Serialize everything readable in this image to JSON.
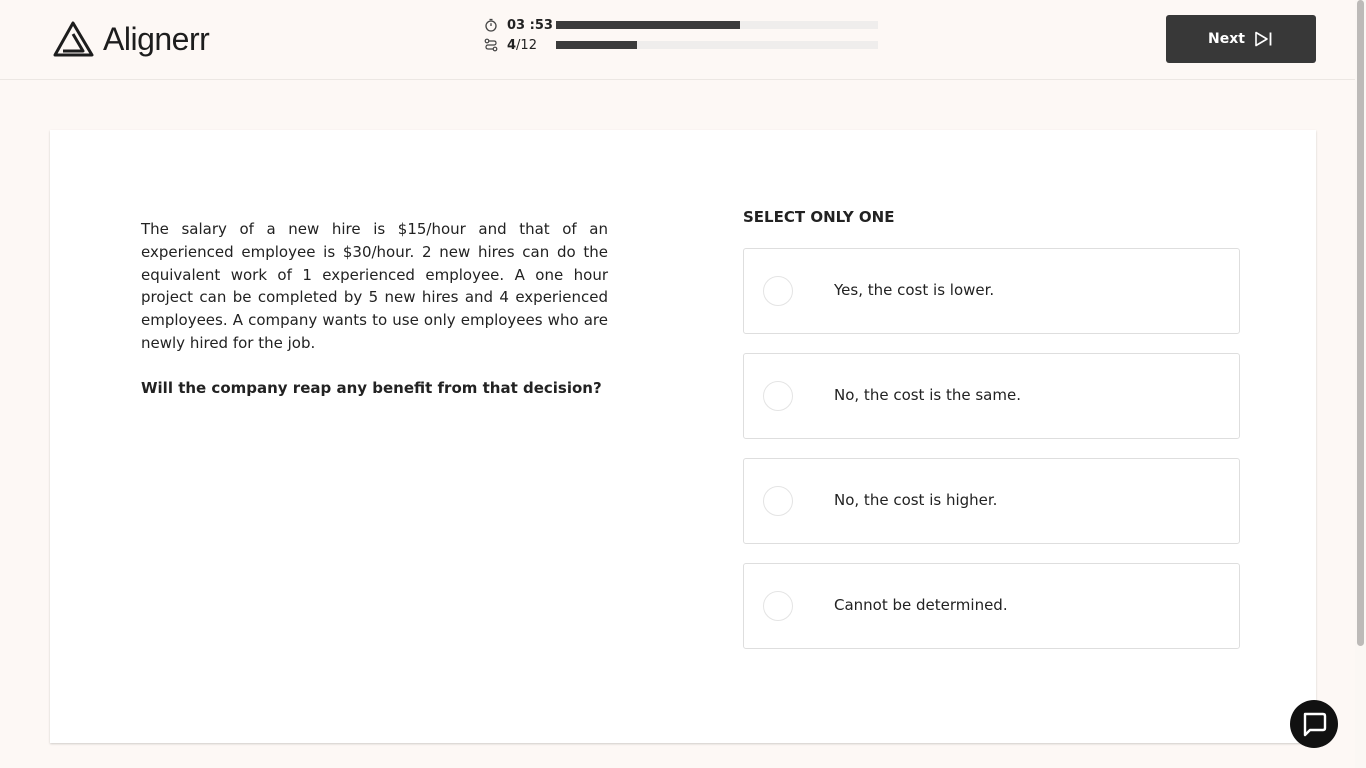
{
  "header": {
    "brand": "Alignerr",
    "timer": {
      "minutes": "03",
      "seconds": "53",
      "separator": ":",
      "progress": 0.57
    },
    "questions": {
      "current": "4",
      "total": "/12",
      "progress": 0.25
    },
    "next_label": "Next"
  },
  "question": {
    "passage": "The salary of a new hire is $15/hour and that of an experienced employee is $30/hour. 2 new hires can do the equivalent work of 1 experienced employee. A one hour project can be completed by 5 new hires and 4 experienced employees. A company wants to use only employees who are newly hired for the job.",
    "prompt": "Will the company reap any benefit from that decision?"
  },
  "answers": {
    "instruction": "SELECT ONLY ONE",
    "options": [
      {
        "label": "Yes, the cost is lower."
      },
      {
        "label": "No, the cost is the same."
      },
      {
        "label": "No, the cost is higher."
      },
      {
        "label": "Cannot be determined."
      }
    ]
  },
  "icons": {
    "logo": "aligner-logo-icon",
    "timer": "stopwatch-icon",
    "questions": "route-icon",
    "next": "skip-forward-icon",
    "chat": "chat-bubble-icon"
  },
  "colors": {
    "background": "#fdf8f5",
    "button": "#383838",
    "bar_fill": "#3b3b3b",
    "bar_track": "#efedec"
  }
}
